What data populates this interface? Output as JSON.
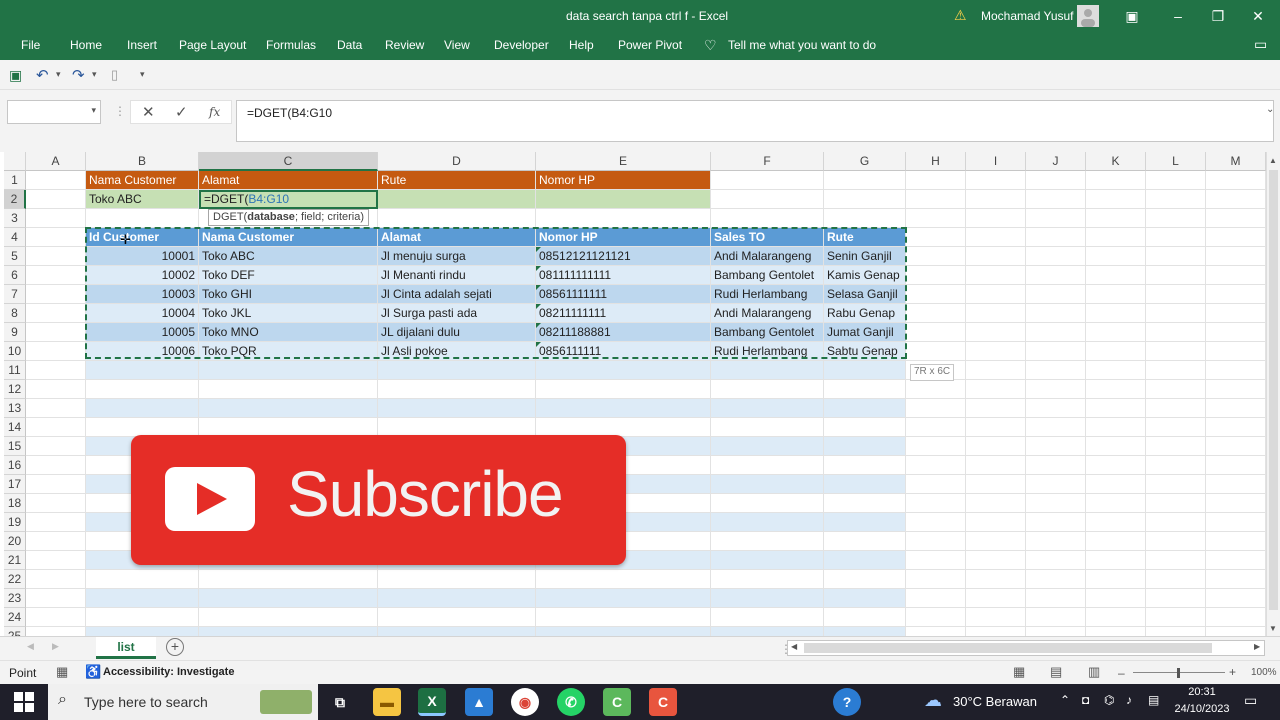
{
  "window": {
    "title": "data search tanpa ctrl f  -  Excel",
    "user": "Mochamad Yusuf"
  },
  "ribbon_tabs": [
    "File",
    "Home",
    "Insert",
    "Page Layout",
    "Formulas",
    "Data",
    "Review",
    "View",
    "Developer",
    "Help",
    "Power Pivot"
  ],
  "tell_me": "Tell me what you want to do",
  "formula_bar": {
    "name_box": "",
    "formula": "=DGET(B4:G10",
    "fx": "fx"
  },
  "columns": [
    "A",
    "B",
    "C",
    "D",
    "E",
    "F",
    "G",
    "H",
    "I",
    "J",
    "K",
    "L",
    "M"
  ],
  "rows": [
    "1",
    "2",
    "3",
    "4",
    "5",
    "6",
    "7",
    "8",
    "9",
    "10",
    "11",
    "12",
    "13",
    "14",
    "15",
    "16",
    "17",
    "18",
    "19",
    "20",
    "21",
    "22",
    "23",
    "24",
    "25"
  ],
  "criteria": {
    "headers": [
      "Nama Customer",
      "Alamat",
      "Rute",
      "Nomor HP"
    ],
    "value": "Toko ABC",
    "editing_prefix": "=DGET(",
    "editing_ref": "B4:G10",
    "tooltip_fn": "DGET(",
    "tooltip_bold": "database",
    "tooltip_rest": "; field; criteria)"
  },
  "table": {
    "headers": [
      "Id Customer",
      "Nama Customer",
      "Alamat",
      "Nomor HP",
      "Sales TO",
      "Rute"
    ],
    "rows": [
      [
        "10001",
        "Toko ABC",
        "Jl menuju surga",
        "08512121121121",
        "Andi Malarangeng",
        "Senin Ganjil"
      ],
      [
        "10002",
        "Toko DEF",
        "Jl Menanti rindu",
        "081111111111",
        "Bambang Gentolet",
        "Kamis Genap"
      ],
      [
        "10003",
        "Toko GHI",
        "Jl Cinta adalah sejati",
        "08561111111",
        "Rudi Herlambang",
        "Selasa Ganjil"
      ],
      [
        "10004",
        "Toko JKL",
        "Jl Surga pasti ada",
        "08211111111",
        "Andi Malarangeng",
        "Rabu Genap"
      ],
      [
        "10005",
        "Toko MNO",
        "JL dijalani dulu",
        "08211188881",
        "Bambang Gentolet",
        "Jumat Ganjil"
      ],
      [
        "10006",
        "Toko PQR",
        "Jl Asli pokoe",
        "0856111111",
        "Rudi Herlambang",
        "Sabtu Genap"
      ]
    ]
  },
  "selection_size": "7R x 6C",
  "subscribe_label": "Subscribe",
  "sheet_tab": "list",
  "status": {
    "mode": "Point",
    "accessibility": "Accessibility: Investigate",
    "zoom": "100%"
  },
  "taskbar": {
    "search_placeholder": "Type here to search",
    "weather": "30°C  Berawan",
    "time": "20:31",
    "date": "24/10/2023"
  },
  "colors": {
    "excel_green": "#217346",
    "orange_header": "#c55a11",
    "table_header": "#5b9bd5",
    "band_light": "#ddebf7",
    "band_mid": "#bdd7ee",
    "criteria_green": "#c6e0b4",
    "subscribe_red": "#e52d27"
  }
}
